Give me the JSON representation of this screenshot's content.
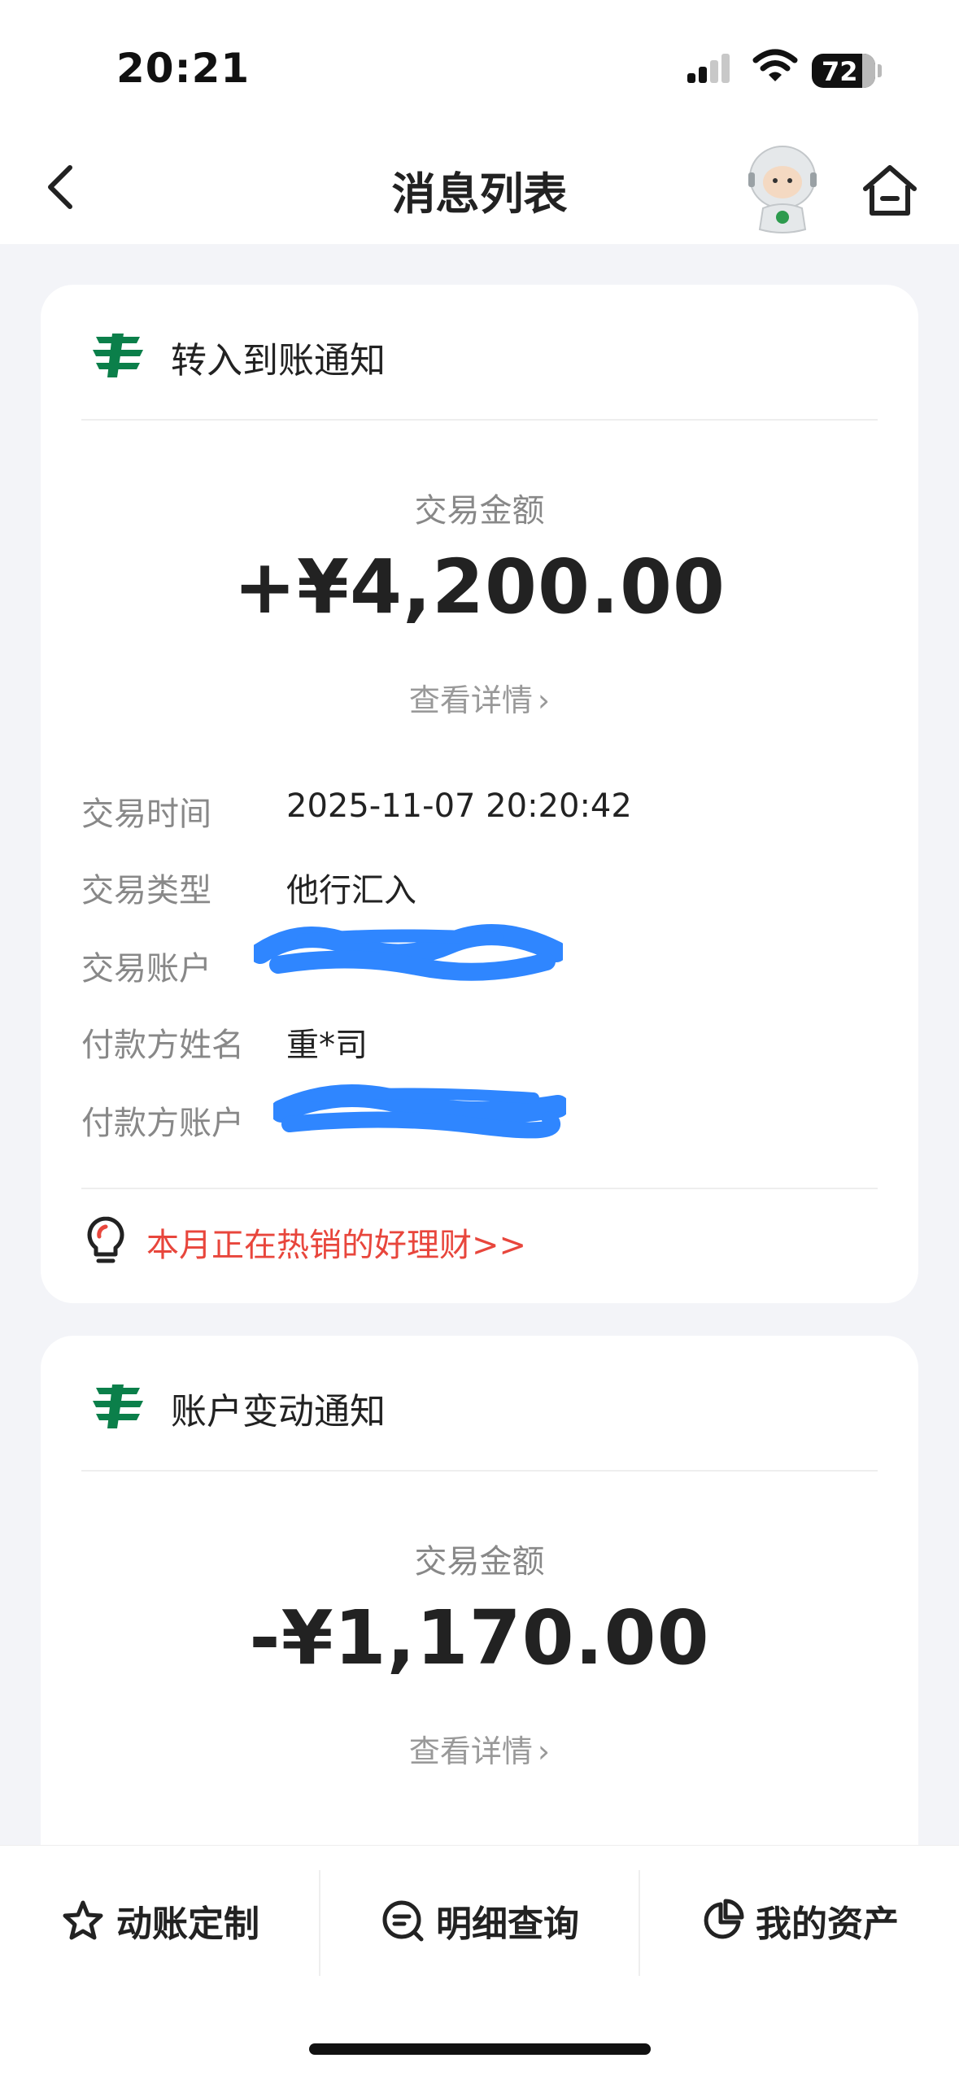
{
  "status_bar": {
    "time": "20:21",
    "battery": "72"
  },
  "nav": {
    "title": "消息列表"
  },
  "cards": [
    {
      "title": "转入到账通知",
      "amount_label": "交易金额",
      "amount": "+¥4,200.00",
      "detail_link": "查看详情",
      "rows": [
        {
          "label": "交易时间",
          "value": "2025-11-07 20:20:42"
        },
        {
          "label": "交易类型",
          "value": "他行汇入"
        },
        {
          "label": "交易账户",
          "value": ""
        },
        {
          "label": "付款方姓名",
          "value": "重*司"
        },
        {
          "label": "付款方账户",
          "value": ""
        }
      ],
      "promo": "本月正在热销的好理财>>"
    },
    {
      "title": "账户变动通知",
      "amount_label": "交易金额",
      "amount": "-¥1,170.00",
      "detail_link": "查看详情"
    }
  ],
  "tabbar": {
    "items": [
      {
        "label": "动账定制",
        "icon": "star-icon"
      },
      {
        "label": "明细查询",
        "icon": "search-list-icon"
      },
      {
        "label": "我的资产",
        "icon": "pie-chart-icon"
      }
    ]
  },
  "colors": {
    "promo": "#e8463c",
    "logo_green": "#0b7f4a",
    "redaction": "#2f86ff"
  }
}
